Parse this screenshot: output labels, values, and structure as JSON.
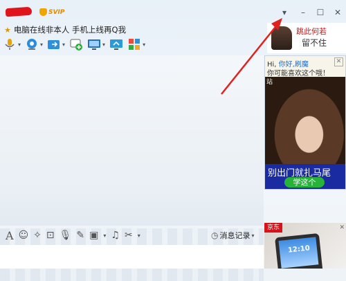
{
  "titlebar": {
    "svip_label": "SVIP",
    "menu_caret": "▾",
    "minimize": "–",
    "maximize": "☐",
    "close": "✕"
  },
  "status": {
    "text": "电脑在线非本人 手机上线再Q我"
  },
  "ad_top": {
    "line1": "跳此何若",
    "line2": "留不住"
  },
  "ad": {
    "greet_prefix": "Hi, ",
    "greet_highlight": "你好,刷魔",
    "subtitle": "你可能喜欢这个哦！",
    "close": "✕",
    "station_label": "站",
    "banner_text": "别出门就扎马尾",
    "cta_button": "学这个"
  },
  "bottom": {
    "history_label": "消息记录",
    "history_caret": "▾"
  },
  "ad2": {
    "brand": "京东",
    "clock": "12:10",
    "close": "✕"
  },
  "colors": {
    "accent_arrow": "#e0211e",
    "brand_red": "#d4141a",
    "ad_banner_blue": "#1a2aa0",
    "cta_green": "#27b33a"
  }
}
